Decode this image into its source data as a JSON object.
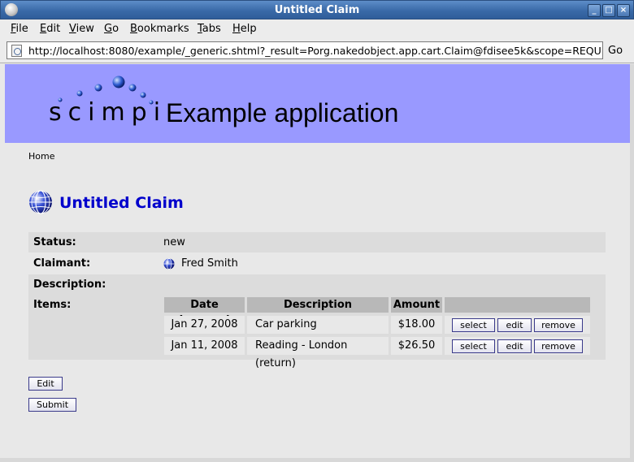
{
  "window": {
    "title": "Untitled Claim"
  },
  "menu": [
    "File",
    "Edit",
    "View",
    "Go",
    "Bookmarks",
    "Tabs",
    "Help"
  ],
  "address": {
    "url": "http://localhost:8080/example/_generic.shtml?_result=Porg.nakedobject.app.cart.Claim@fdisee5k&scope=REQUEST",
    "go_label": "Go"
  },
  "banner": {
    "logo_text": "scimpi",
    "app_title": "Example application"
  },
  "breadcrumb": "Home",
  "object": {
    "title": "Untitled Claim",
    "status_label": "Status:",
    "status_value": "new",
    "claimant_label": "Claimant:",
    "claimant_value": "Fred Smith",
    "description_label": "Description:",
    "description_value": "",
    "items_label": "Items:"
  },
  "items": {
    "headers": [
      "Date Incurred",
      "Description",
      "Amount",
      ""
    ],
    "rows": [
      {
        "date": "Jan 27, 2008",
        "description": "Car parking",
        "amount": "$18.00"
      },
      {
        "date": "Jan 11, 2008",
        "description": "Reading - London (return)",
        "amount": "$26.50"
      }
    ],
    "row_actions": [
      "select",
      "edit",
      "remove"
    ]
  },
  "actions": {
    "edit": "Edit",
    "submit": "Submit"
  },
  "colors": {
    "banner": "#9999ff",
    "heading": "#0000cc"
  }
}
